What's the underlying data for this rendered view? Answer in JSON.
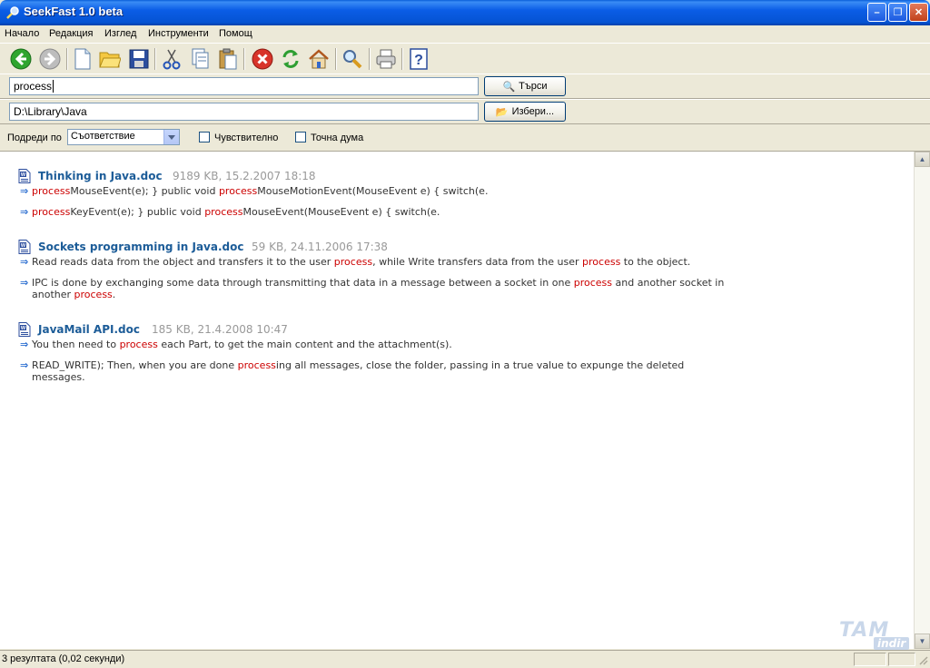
{
  "window": {
    "title": "SeekFast 1.0 beta",
    "minimize_glyph": "–",
    "maximize_glyph": "❐",
    "close_glyph": "✕"
  },
  "menu": [
    "Начало",
    "Редакция",
    "Изглед",
    "Инструменти",
    "Помощ"
  ],
  "toolbar": {
    "icons": [
      "back-icon",
      "forward-icon",
      "new-document-icon",
      "open-folder-icon",
      "save-icon",
      "cut-icon",
      "copy-icon",
      "paste-icon",
      "stop-icon",
      "refresh-icon",
      "home-icon",
      "search-icon",
      "print-icon",
      "help-icon"
    ]
  },
  "search": {
    "value": "process",
    "button_label": "Търси"
  },
  "path": {
    "value": "D:\\Library\\Java",
    "button_label": "Избери..."
  },
  "options": {
    "sort_label": "Подреди по",
    "sort_value": "Съответствие",
    "case_label": "Чувствително",
    "whole_word_label": "Точна дума"
  },
  "results": [
    {
      "name": "Thinking in Java.doc",
      "meta": "9189 KB, 15.2.2007 18:18",
      "snippets": [
        [
          [
            "hl",
            "process"
          ],
          [
            "t",
            "MouseEvent(e); } public void "
          ],
          [
            "hl",
            "process"
          ],
          [
            "t",
            "MouseMotionEvent(MouseEvent e) { switch(e."
          ]
        ],
        [
          [
            "hl",
            "process"
          ],
          [
            "t",
            "KeyEvent(e); } public void "
          ],
          [
            "hl",
            "process"
          ],
          [
            "t",
            "MouseEvent(MouseEvent e) { switch(e."
          ]
        ]
      ]
    },
    {
      "name": "Sockets programming in Java.doc",
      "meta": "59 KB, 24.11.2006 17:38",
      "snippets": [
        [
          [
            "t",
            "Read reads data from the object and transfers it to the user "
          ],
          [
            "hl",
            "process"
          ],
          [
            "t",
            ", while Write transfers data from the user "
          ],
          [
            "hl",
            "process"
          ],
          [
            "t",
            " to the object."
          ]
        ],
        [
          [
            "t",
            "IPC is done by exchanging some data through transmitting that data in a message between a socket in one "
          ],
          [
            "hl",
            "process"
          ],
          [
            "t",
            " and another socket in another "
          ],
          [
            "hl",
            "process"
          ],
          [
            "t",
            "."
          ]
        ]
      ]
    },
    {
      "name": "JavaMail API.doc",
      "meta": "185 KB, 21.4.2008 10:47",
      "snippets": [
        [
          [
            "t",
            "You then need to "
          ],
          [
            "hl",
            "process"
          ],
          [
            "t",
            " each Part, to get the main content and the attachment(s)."
          ]
        ],
        [
          [
            "t",
            "READ_WRITE); Then, when you are done "
          ],
          [
            "hl",
            "process"
          ],
          [
            "t",
            "ing all messages, close the folder, passing in a true value to expunge the deleted messages."
          ]
        ]
      ]
    }
  ],
  "status": {
    "text": "3 резултата (0,02 секунди)"
  },
  "watermark": {
    "line1": "TAM",
    "line2": "indir"
  },
  "colors": {
    "highlight": "#cc0000",
    "doc_title": "#1c5c98",
    "meta": "#999999",
    "arrow": "#2d6fd1"
  }
}
